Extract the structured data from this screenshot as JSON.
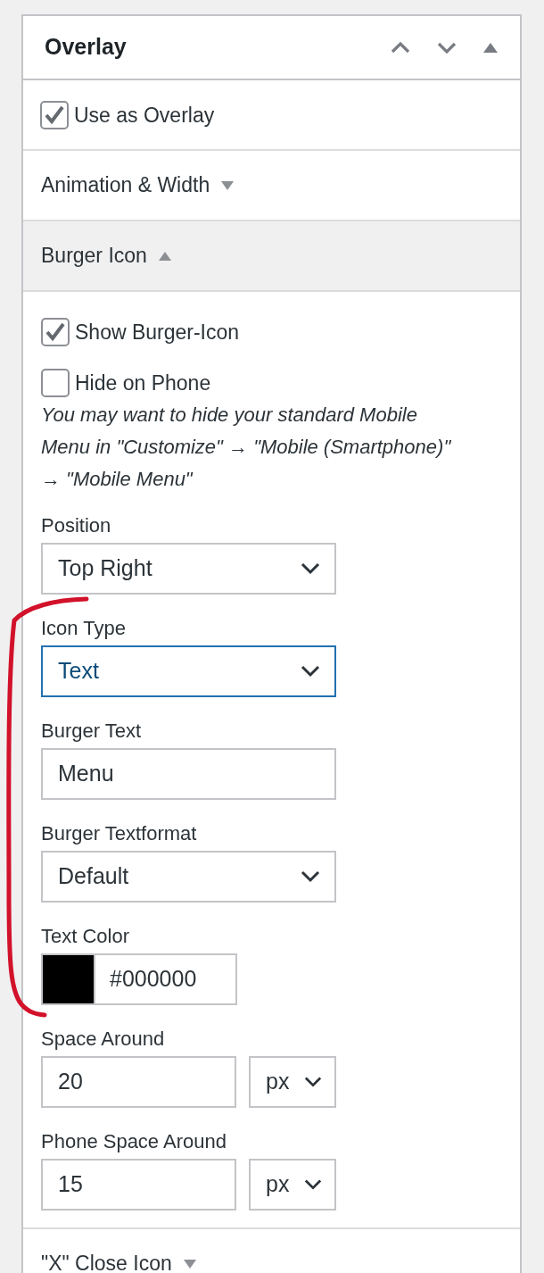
{
  "panel": {
    "title": "Overlay"
  },
  "sections": [
    {
      "kind": "checkbox",
      "label": "Use as Overlay",
      "checked": true
    },
    {
      "kind": "accordion",
      "label": "Animation & Width",
      "expanded": false
    },
    {
      "kind": "accordion",
      "label": "Burger Icon",
      "expanded": true,
      "fields": [
        {
          "kind": "checkbox",
          "label": "Show Burger-Icon",
          "checked": true
        },
        {
          "kind": "checkbox",
          "label": "Hide on Phone",
          "checked": false
        },
        {
          "kind": "note",
          "text": "You may want to hide your standard Mobile Menu in \"Customize\" → \"Mobile (Smartphone)\" → \"Mobile Menu\""
        },
        {
          "kind": "select",
          "label": "Position",
          "value": "Top Right",
          "focused": false
        },
        {
          "kind": "select",
          "label": "Icon Type",
          "value": "Text",
          "focused": true
        },
        {
          "kind": "text",
          "label": "Burger Text",
          "value": "Menu"
        },
        {
          "kind": "select",
          "label": "Burger Textformat",
          "value": "Default",
          "focused": false
        },
        {
          "kind": "color",
          "label": "Text Color",
          "color": "#000000",
          "value": "#000000"
        },
        {
          "kind": "number",
          "label": "Space Around",
          "value": "20",
          "unit": "px"
        },
        {
          "kind": "number",
          "label": "Phone Space Around",
          "value": "15",
          "unit": "px"
        }
      ]
    },
    {
      "kind": "accordion",
      "label": "\"X\" Close Icon",
      "expanded": false
    }
  ]
}
